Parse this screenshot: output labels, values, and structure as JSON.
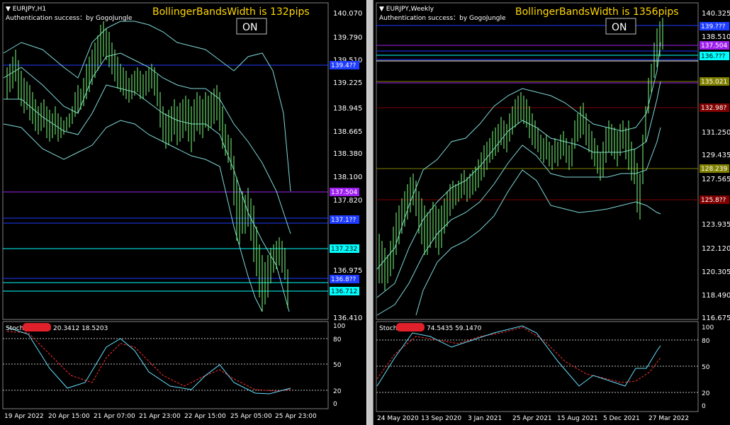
{
  "left": {
    "title": "EURJPY,H1",
    "auth": "Authentication success：by GogoJungle",
    "bbw": "BollingerBandsWidth is 132pips",
    "on": "ON",
    "prices": [
      "140.070",
      "139.790",
      "139.510",
      "139.225",
      "138.945",
      "138.665",
      "138.380",
      "138.100",
      "137.820",
      "137.504",
      "137.232",
      "136.975",
      "136.712",
      "136.410"
    ],
    "tags": [
      {
        "text": "139.4??",
        "color": "#1e3cff"
      },
      {
        "text": "137.504",
        "color": "#a020f0"
      },
      {
        "text": "137.1??",
        "color": "#1e3cff"
      },
      {
        "text": "137.232",
        "color": "#00ffff"
      },
      {
        "text": "136.8??",
        "color": "#1e3cff"
      },
      {
        "text": "136.712",
        "color": "#00ffff"
      }
    ],
    "stoch": {
      "label": "Stoch",
      "values": "20.3412 18.5203",
      "levels": [
        "100",
        "80",
        "50",
        "20",
        "0"
      ]
    },
    "xlabels": [
      "19 Apr 2022",
      "20 Apr 15:00",
      "21 Apr 07:00",
      "21 Apr 23:00",
      "22 Apr 15:00",
      "25 Apr 05:00",
      "25 Apr 23:00"
    ]
  },
  "right": {
    "title": "EURJPY,Weekly",
    "auth": "Authentication success：by GogoJungle",
    "bbw": "BollingerBandsWidth is 1356pips",
    "on": "ON",
    "prices": [
      "140.325",
      "138.510",
      "137.504",
      "135.021",
      "132.98?",
      "131.250",
      "129.435",
      "128.239",
      "127.565",
      "125.8??",
      "123.935",
      "122.120",
      "120.305",
      "118.490",
      "116.675"
    ],
    "tags": [
      {
        "text": "139.???",
        "color": "#1e3cff"
      },
      {
        "text": "137.504",
        "color": "#a020f0"
      },
      {
        "text": "136.???",
        "color": "#00ffff"
      },
      {
        "text": "135.021",
        "color": "#808000"
      },
      {
        "text": "132.98?",
        "color": "#800000"
      },
      {
        "text": "128.239",
        "color": "#808000"
      },
      {
        "text": "125.8??",
        "color": "#800000"
      }
    ],
    "stoch": {
      "label": "Stoch",
      "values": "74.5435 59.1470",
      "levels": [
        "100",
        "80",
        "50",
        "20",
        "0"
      ]
    },
    "xlabels": [
      "24 May 2020",
      "13 Sep 2020",
      "3 Jan 2021",
      "25 Apr 2021",
      "15 Aug 2021",
      "5 Dec 2021",
      "27 Mar 2022"
    ]
  },
  "colors": {
    "candle": "#7cff7c",
    "band": "#7fd8d8",
    "stochMain": "#66e0ff",
    "stochSignal": "#ff3030",
    "bbwText": "#ffd700"
  }
}
